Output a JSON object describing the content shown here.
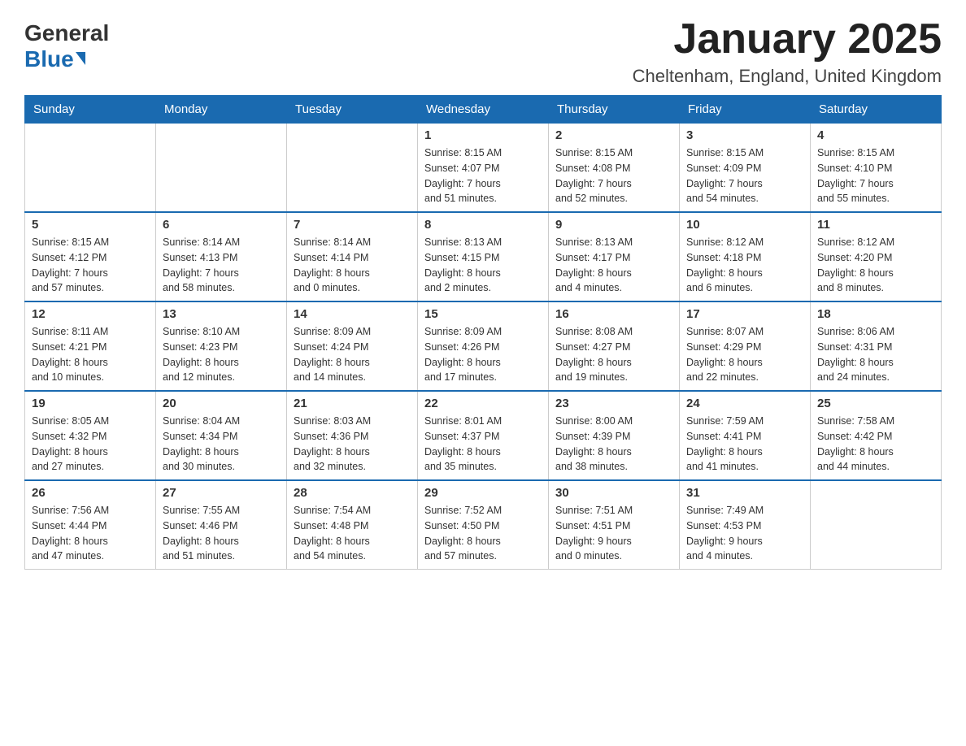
{
  "header": {
    "logo_general": "General",
    "logo_blue": "Blue",
    "month_title": "January 2025",
    "location": "Cheltenham, England, United Kingdom"
  },
  "days_of_week": [
    "Sunday",
    "Monday",
    "Tuesday",
    "Wednesday",
    "Thursday",
    "Friday",
    "Saturday"
  ],
  "weeks": [
    [
      {
        "day": "",
        "info": ""
      },
      {
        "day": "",
        "info": ""
      },
      {
        "day": "",
        "info": ""
      },
      {
        "day": "1",
        "info": "Sunrise: 8:15 AM\nSunset: 4:07 PM\nDaylight: 7 hours\nand 51 minutes."
      },
      {
        "day": "2",
        "info": "Sunrise: 8:15 AM\nSunset: 4:08 PM\nDaylight: 7 hours\nand 52 minutes."
      },
      {
        "day": "3",
        "info": "Sunrise: 8:15 AM\nSunset: 4:09 PM\nDaylight: 7 hours\nand 54 minutes."
      },
      {
        "day": "4",
        "info": "Sunrise: 8:15 AM\nSunset: 4:10 PM\nDaylight: 7 hours\nand 55 minutes."
      }
    ],
    [
      {
        "day": "5",
        "info": "Sunrise: 8:15 AM\nSunset: 4:12 PM\nDaylight: 7 hours\nand 57 minutes."
      },
      {
        "day": "6",
        "info": "Sunrise: 8:14 AM\nSunset: 4:13 PM\nDaylight: 7 hours\nand 58 minutes."
      },
      {
        "day": "7",
        "info": "Sunrise: 8:14 AM\nSunset: 4:14 PM\nDaylight: 8 hours\nand 0 minutes."
      },
      {
        "day": "8",
        "info": "Sunrise: 8:13 AM\nSunset: 4:15 PM\nDaylight: 8 hours\nand 2 minutes."
      },
      {
        "day": "9",
        "info": "Sunrise: 8:13 AM\nSunset: 4:17 PM\nDaylight: 8 hours\nand 4 minutes."
      },
      {
        "day": "10",
        "info": "Sunrise: 8:12 AM\nSunset: 4:18 PM\nDaylight: 8 hours\nand 6 minutes."
      },
      {
        "day": "11",
        "info": "Sunrise: 8:12 AM\nSunset: 4:20 PM\nDaylight: 8 hours\nand 8 minutes."
      }
    ],
    [
      {
        "day": "12",
        "info": "Sunrise: 8:11 AM\nSunset: 4:21 PM\nDaylight: 8 hours\nand 10 minutes."
      },
      {
        "day": "13",
        "info": "Sunrise: 8:10 AM\nSunset: 4:23 PM\nDaylight: 8 hours\nand 12 minutes."
      },
      {
        "day": "14",
        "info": "Sunrise: 8:09 AM\nSunset: 4:24 PM\nDaylight: 8 hours\nand 14 minutes."
      },
      {
        "day": "15",
        "info": "Sunrise: 8:09 AM\nSunset: 4:26 PM\nDaylight: 8 hours\nand 17 minutes."
      },
      {
        "day": "16",
        "info": "Sunrise: 8:08 AM\nSunset: 4:27 PM\nDaylight: 8 hours\nand 19 minutes."
      },
      {
        "day": "17",
        "info": "Sunrise: 8:07 AM\nSunset: 4:29 PM\nDaylight: 8 hours\nand 22 minutes."
      },
      {
        "day": "18",
        "info": "Sunrise: 8:06 AM\nSunset: 4:31 PM\nDaylight: 8 hours\nand 24 minutes."
      }
    ],
    [
      {
        "day": "19",
        "info": "Sunrise: 8:05 AM\nSunset: 4:32 PM\nDaylight: 8 hours\nand 27 minutes."
      },
      {
        "day": "20",
        "info": "Sunrise: 8:04 AM\nSunset: 4:34 PM\nDaylight: 8 hours\nand 30 minutes."
      },
      {
        "day": "21",
        "info": "Sunrise: 8:03 AM\nSunset: 4:36 PM\nDaylight: 8 hours\nand 32 minutes."
      },
      {
        "day": "22",
        "info": "Sunrise: 8:01 AM\nSunset: 4:37 PM\nDaylight: 8 hours\nand 35 minutes."
      },
      {
        "day": "23",
        "info": "Sunrise: 8:00 AM\nSunset: 4:39 PM\nDaylight: 8 hours\nand 38 minutes."
      },
      {
        "day": "24",
        "info": "Sunrise: 7:59 AM\nSunset: 4:41 PM\nDaylight: 8 hours\nand 41 minutes."
      },
      {
        "day": "25",
        "info": "Sunrise: 7:58 AM\nSunset: 4:42 PM\nDaylight: 8 hours\nand 44 minutes."
      }
    ],
    [
      {
        "day": "26",
        "info": "Sunrise: 7:56 AM\nSunset: 4:44 PM\nDaylight: 8 hours\nand 47 minutes."
      },
      {
        "day": "27",
        "info": "Sunrise: 7:55 AM\nSunset: 4:46 PM\nDaylight: 8 hours\nand 51 minutes."
      },
      {
        "day": "28",
        "info": "Sunrise: 7:54 AM\nSunset: 4:48 PM\nDaylight: 8 hours\nand 54 minutes."
      },
      {
        "day": "29",
        "info": "Sunrise: 7:52 AM\nSunset: 4:50 PM\nDaylight: 8 hours\nand 57 minutes."
      },
      {
        "day": "30",
        "info": "Sunrise: 7:51 AM\nSunset: 4:51 PM\nDaylight: 9 hours\nand 0 minutes."
      },
      {
        "day": "31",
        "info": "Sunrise: 7:49 AM\nSunset: 4:53 PM\nDaylight: 9 hours\nand 4 minutes."
      },
      {
        "day": "",
        "info": ""
      }
    ]
  ]
}
